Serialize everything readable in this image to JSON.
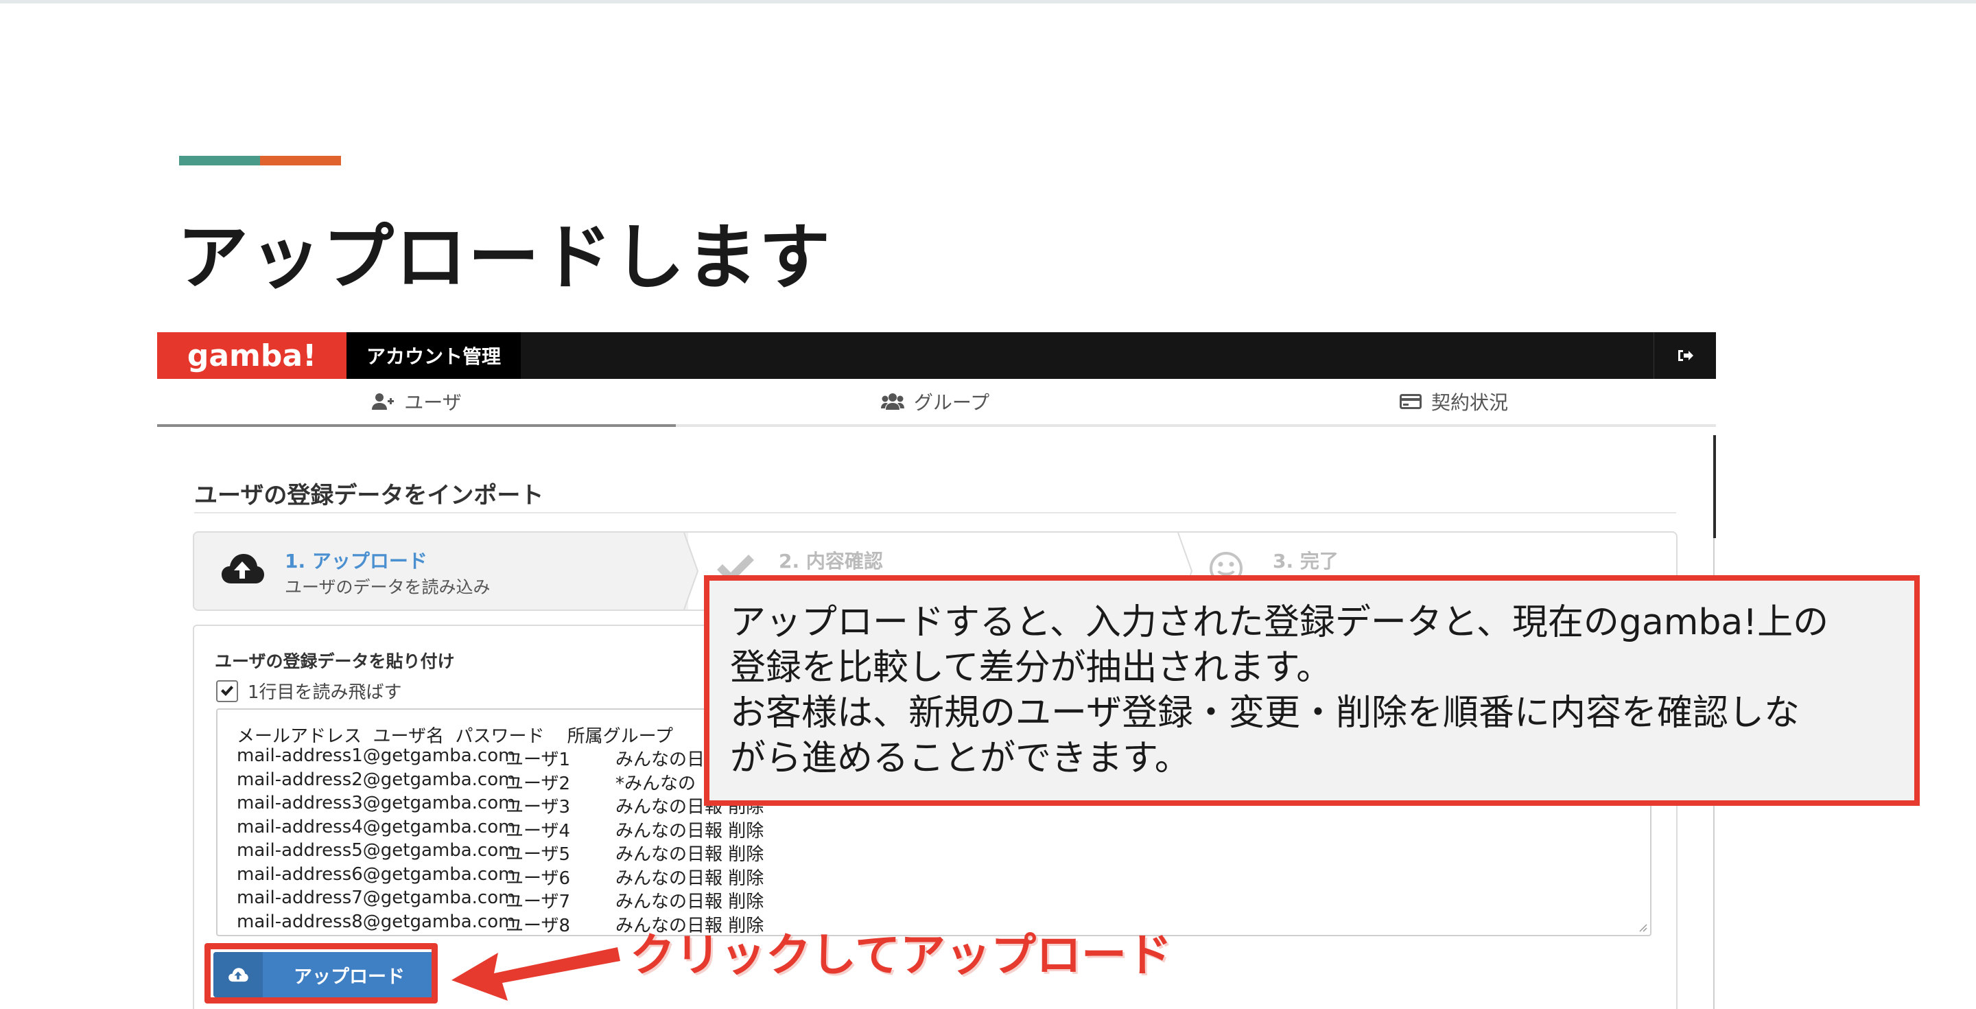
{
  "slide": {
    "title": "アップロードします",
    "accent_colors": [
      "#4a9a8a",
      "#e0622c"
    ]
  },
  "app": {
    "logo": "gamba!",
    "header_tab": "アカウント管理",
    "logout_icon": "sign-out-icon",
    "tabs": [
      {
        "label": "ユーザ",
        "icon": "user-plus-icon",
        "active": true
      },
      {
        "label": "グループ",
        "icon": "users-icon",
        "active": false
      },
      {
        "label": "契約状況",
        "icon": "credit-card-icon",
        "active": false
      }
    ],
    "section_title": "ユーザの登録データをインポート",
    "steps": [
      {
        "title": "1. アップロード",
        "subtitle": "ユーザのデータを読み込み",
        "icon": "cloud-upload-icon"
      },
      {
        "title": "2. 内容確認",
        "subtitle": "",
        "icon": "check-icon"
      },
      {
        "title": "3. 完了",
        "subtitle": "",
        "icon": "smile-icon"
      }
    ],
    "paste_label": "ユーザの登録データを貼り付け",
    "skip_first_row": {
      "label": "1行目を読み飛ばす",
      "checked": true
    },
    "textarea": {
      "header": "メールアドレス  ユーザ名  パスワード    所属グループ",
      "rows": [
        {
          "email": "mail-address1@getgamba.com",
          "user": "ユーザ1",
          "group": "みんなの日"
        },
        {
          "email": "mail-address2@getgamba.com",
          "user": "ユーザ2",
          "group": "*みんなの"
        },
        {
          "email": "mail-address3@getgamba.com",
          "user": "ユーザ3",
          "group": "みんなの日報 削除"
        },
        {
          "email": "mail-address4@getgamba.com",
          "user": "ユーザ4",
          "group": "みんなの日報 削除"
        },
        {
          "email": "mail-address5@getgamba.com",
          "user": "ユーザ5",
          "group": "みんなの日報 削除"
        },
        {
          "email": "mail-address6@getgamba.com",
          "user": "ユーザ6",
          "group": "みんなの日報 削除"
        },
        {
          "email": "mail-address7@getgamba.com",
          "user": "ユーザ7",
          "group": "みんなの日報 削除"
        },
        {
          "email": "mail-address8@getgamba.com",
          "user": "ユーザ8",
          "group": "みんなの日報 削除"
        }
      ]
    },
    "upload_button": "アップロード"
  },
  "annotations": {
    "callout_lines": [
      "アップロードすると、入力された登録データと、現在のgamba!上の",
      "登録を比較して差分が抽出されます。",
      "お客様は、新規のユーザ登録・変更・削除を順番に内容を確認しな",
      "がら進めることができます。"
    ],
    "click_hint": "クリックしてアップロード",
    "highlight_color": "#e63a2f"
  }
}
